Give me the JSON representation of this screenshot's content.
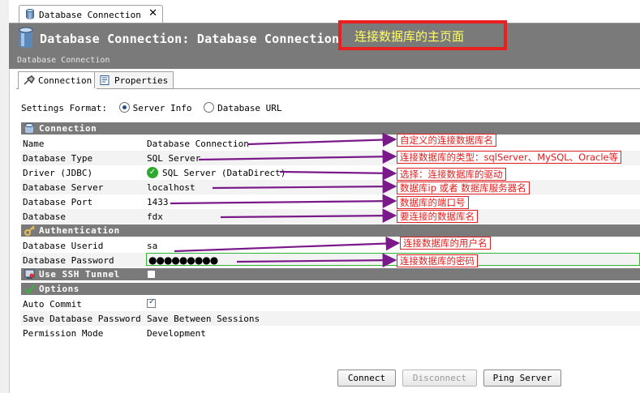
{
  "editor_tab": {
    "label": "Database Connection",
    "close": "✕"
  },
  "header": {
    "title": "Database Connection: Database Connection",
    "subtitle": "Database Connection",
    "annotation": "连接数据库的主页面"
  },
  "subtabs": [
    {
      "label": "Connection"
    },
    {
      "label": "Properties"
    }
  ],
  "settings_format": {
    "label": "Settings Format:",
    "options": [
      {
        "label": "Server Info",
        "selected": true
      },
      {
        "label": "Database URL",
        "selected": false
      }
    ]
  },
  "sections": {
    "connection": "Connection",
    "authentication": "Authentication",
    "ssh": "Use SSH Tunnel",
    "options": "Options"
  },
  "connection_rows": [
    {
      "key": "Name",
      "value": "Database Connection",
      "note": "自定义的连接数据库名"
    },
    {
      "key": "Database Type",
      "value": "SQL Server",
      "note": "连接数据库的类型：sqlServer、MySQL、Oracle等"
    },
    {
      "key": "Driver (JDBC)",
      "value": "SQL Server (DataDirect)",
      "note": "选择：连接数据库的驱动"
    },
    {
      "key": "Database Server",
      "value": "localhost",
      "note": "数据库ip 或者 数据库服务器名"
    },
    {
      "key": "Database Port",
      "value": "1433",
      "note": "数据库的端口号"
    },
    {
      "key": "Database",
      "value": "fdx",
      "note": "要连接的数据库名"
    }
  ],
  "auth_rows": [
    {
      "key": "Database Userid",
      "value": "sa",
      "note": "连接数据库的用户名"
    },
    {
      "key": "Database Password",
      "value": "●●●●●●●●●",
      "note": "连接数据库的密码"
    }
  ],
  "ssh_checked": false,
  "option_rows": [
    {
      "key": "Auto Commit",
      "checked": true
    },
    {
      "key": "Save Database Password",
      "value": "Save Between Sessions"
    },
    {
      "key": "Permission Mode",
      "value": "Development"
    }
  ],
  "buttons": {
    "connect": "Connect",
    "disconnect": "Disconnect",
    "ping": "Ping Server"
  },
  "colors": {
    "section_bg": "#7a7a7a",
    "annotation_red": "#e02020",
    "arrow_purple": "#7a1a8a",
    "pw_border": "#2fb52f"
  }
}
